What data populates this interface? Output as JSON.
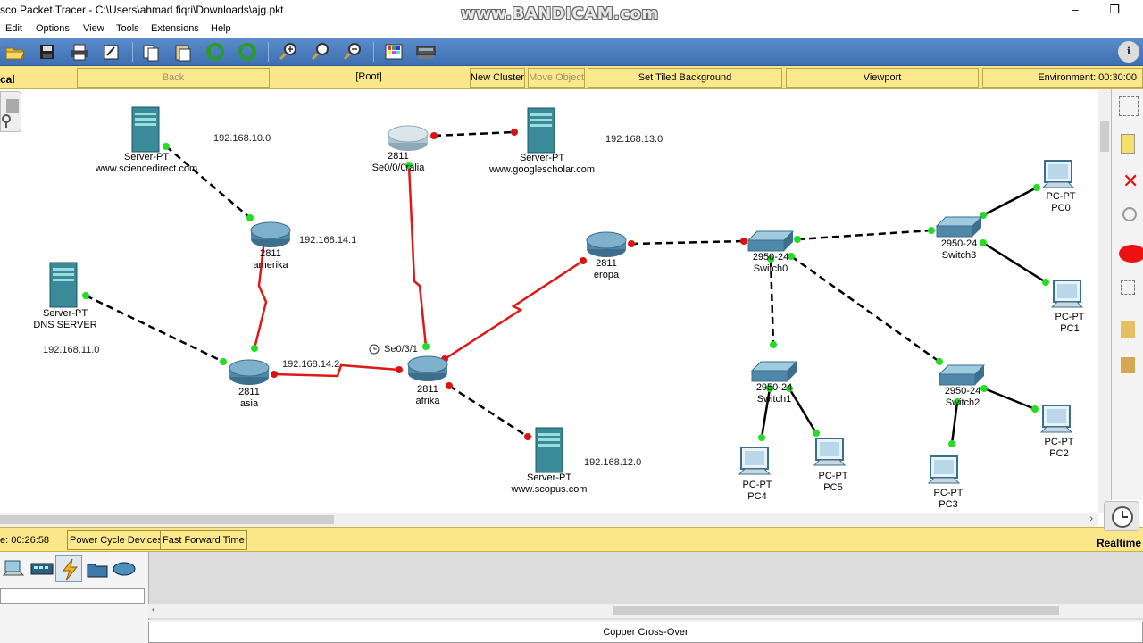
{
  "window": {
    "title": "sco Packet Tracer - C:\\Users\\ahmad fiqri\\Downloads\\ajg.pkt",
    "watermark": "www.BANDICAM.com",
    "minimize": "–",
    "restore": "❐"
  },
  "menu": [
    "Edit",
    "Options",
    "View",
    "Tools",
    "Extensions",
    "Help"
  ],
  "toolbar": {
    "icons": [
      "open-icon",
      "save-icon",
      "print-icon",
      "activity-wizard-icon",
      "copy-icon",
      "paste-icon",
      "undo-icon",
      "redo-icon",
      "zoom-in-icon",
      "zoom-reset-icon",
      "zoom-out-icon",
      "palette-icon",
      "custom-device-icon"
    ],
    "info_icon": "i"
  },
  "logical_bar": {
    "label": "cal",
    "back": "Back",
    "root": "[Root]",
    "new_cluster": "New Cluster",
    "move_object": "Move Object",
    "set_tiled_background": "Set Tiled Background",
    "viewport": "Viewport",
    "environment": "Environment: 00:30:00"
  },
  "network": {
    "colors": {
      "serial": "#e01818",
      "copper": "#000000",
      "link_up": "#22dd22",
      "link_down": "#dd1111"
    },
    "devices": [
      {
        "id": "server-sciencedirect",
        "type": "server",
        "labels": [
          "Server-PT",
          "www.sciencedirect.com"
        ]
      },
      {
        "id": "server-dns",
        "type": "server",
        "labels": [
          "Server-PT",
          "DNS SERVER"
        ]
      },
      {
        "id": "server-googlescholar",
        "type": "server",
        "labels": [
          "Server-PT",
          "www.googlescholar.com"
        ]
      },
      {
        "id": "server-scopus",
        "type": "server",
        "labels": [
          "Server-PT",
          "www.scopus.com"
        ]
      },
      {
        "id": "router-australia",
        "type": "router",
        "labels": [
          "2811",
          "Se0/0/0ralia"
        ]
      },
      {
        "id": "router-amerika",
        "type": "router",
        "labels": [
          "2811",
          "amerika"
        ]
      },
      {
        "id": "router-asia",
        "type": "router",
        "labels": [
          "2811",
          "asia"
        ]
      },
      {
        "id": "router-afrika",
        "type": "router",
        "labels": [
          "2811",
          "afrika"
        ]
      },
      {
        "id": "router-eropa",
        "type": "router",
        "labels": [
          "2811",
          "eropa"
        ]
      },
      {
        "id": "switch0",
        "type": "switch",
        "labels": [
          "2950-24",
          "Switch0"
        ]
      },
      {
        "id": "switch1",
        "type": "switch",
        "labels": [
          "2950-24",
          "Switch1"
        ]
      },
      {
        "id": "switch2",
        "type": "switch",
        "labels": [
          "2950-24",
          "Switch2"
        ]
      },
      {
        "id": "switch3",
        "type": "switch",
        "labels": [
          "2950-24",
          "Switch3"
        ]
      },
      {
        "id": "pc0",
        "type": "pc",
        "labels": [
          "PC-PT",
          "PC0"
        ]
      },
      {
        "id": "pc1",
        "type": "pc",
        "labels": [
          "PC-PT",
          "PC1"
        ]
      },
      {
        "id": "pc2",
        "type": "pc",
        "labels": [
          "PC-PT",
          "PC2"
        ]
      },
      {
        "id": "pc3",
        "type": "pc",
        "labels": [
          "PC-PT",
          "PC3"
        ]
      },
      {
        "id": "pc4",
        "type": "pc",
        "labels": [
          "PC-PT",
          "PC4"
        ]
      },
      {
        "id": "pc5",
        "type": "pc",
        "labels": [
          "PC-PT",
          "PC5"
        ]
      }
    ],
    "network_labels": [
      "192.168.10.0",
      "192.168.13.0",
      "192.168.14.1",
      "192.168.11.0",
      "192.168.14.2",
      "192.168.12.0"
    ],
    "port_label": "Se0/3/1"
  },
  "realtime_bar": {
    "time": "e: 00:26:58",
    "power_cycle": "Power Cycle Devices",
    "fast_forward": "Fast Forward Time",
    "mode": "Realtime"
  },
  "bottom": {
    "connection_name": "Copper Cross-Over"
  }
}
